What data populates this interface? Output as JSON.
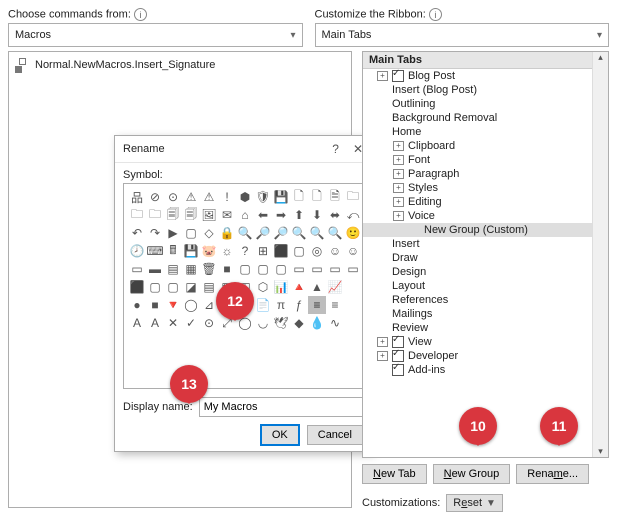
{
  "top": {
    "left_label": "Choose commands from:",
    "right_label": "Customize the Ribbon:",
    "left_value": "Macros",
    "right_value": "Main Tabs"
  },
  "macro_item": "Normal.NewMacros.Insert_Signature",
  "tree": {
    "header": "Main Tabs",
    "nodes": [
      {
        "d": 0,
        "exp": "+",
        "chk": true,
        "label": "Blog Post"
      },
      {
        "d": 0,
        "exp": "",
        "chk": null,
        "label": "Insert (Blog Post)"
      },
      {
        "d": 0,
        "exp": "",
        "chk": null,
        "label": "Outlining"
      },
      {
        "d": 0,
        "exp": "",
        "chk": null,
        "label": "Background Removal"
      },
      {
        "d": 0,
        "exp": "",
        "chk": null,
        "label": "Home"
      },
      {
        "d": 1,
        "exp": "+",
        "chk": null,
        "label": "Clipboard"
      },
      {
        "d": 1,
        "exp": "+",
        "chk": null,
        "label": "Font"
      },
      {
        "d": 1,
        "exp": "+",
        "chk": null,
        "label": "Paragraph"
      },
      {
        "d": 1,
        "exp": "+",
        "chk": null,
        "label": "Styles"
      },
      {
        "d": 1,
        "exp": "+",
        "chk": null,
        "label": "Editing"
      },
      {
        "d": 1,
        "exp": "+",
        "chk": null,
        "label": "Voice"
      },
      {
        "d": 2,
        "exp": "",
        "chk": null,
        "label": "New Group (Custom)",
        "sel": true
      },
      {
        "d": 0,
        "exp": "",
        "chk": null,
        "label": "Insert"
      },
      {
        "d": 0,
        "exp": "",
        "chk": null,
        "label": "Draw"
      },
      {
        "d": 0,
        "exp": "",
        "chk": null,
        "label": "Design"
      },
      {
        "d": 0,
        "exp": "",
        "chk": null,
        "label": "Layout"
      },
      {
        "d": 0,
        "exp": "",
        "chk": null,
        "label": "References"
      },
      {
        "d": 0,
        "exp": "",
        "chk": null,
        "label": "Mailings"
      },
      {
        "d": 0,
        "exp": "",
        "chk": null,
        "label": "Review"
      },
      {
        "d": 0,
        "exp": "+",
        "chk": true,
        "label": "View"
      },
      {
        "d": 0,
        "exp": "+",
        "chk": true,
        "label": "Developer"
      },
      {
        "d": 0,
        "exp": "",
        "chk": true,
        "label": "Add-ins"
      }
    ]
  },
  "buttons": {
    "new_tab": "New Tab",
    "new_group": "New Group",
    "rename": "Rename...",
    "customizations": "Customizations:",
    "reset": "Reset"
  },
  "dialog": {
    "title": "Rename",
    "symbol_label": "Symbol:",
    "display_name_label": "Display name:",
    "display_name_value": "My Macros",
    "ok": "OK",
    "cancel": "Cancel",
    "symbols": [
      "品",
      "⊘",
      "⊙",
      "⚠",
      "⚠",
      "!",
      "⬢",
      "🛡",
      "💾",
      "🗋",
      "🗋",
      "🗎",
      "🗀",
      "🗀",
      "🗀",
      "🗐",
      "🗐",
      "🖼",
      "✉",
      "⌂",
      "⬅",
      "➡",
      "⬆",
      "⬇",
      "⬌",
      "⤺",
      "↶",
      "↷",
      "▶",
      "▢",
      "◇",
      "🔒",
      "🔍",
      "🔎",
      "🔎",
      "🔍",
      "🔍",
      "🔍",
      "🙂",
      "🕗",
      "⌨",
      "🖩",
      "💾",
      "🐷",
      "☼",
      "?",
      "⊞",
      "⬛",
      "▢",
      "◎",
      "☺",
      "☺",
      "▭",
      "▬",
      "▤",
      "▦",
      "🗑",
      "■",
      "▢",
      "▢",
      "▢",
      "▭",
      "▭",
      "▭",
      "▭",
      "⬛",
      "▢",
      "▢",
      "◪",
      "▤",
      "▦",
      "◫",
      "⬡",
      "📊",
      "🔺",
      "▲",
      "📈",
      "",
      "●",
      "■",
      "🔻",
      "◯",
      "⊿",
      "🗂",
      "🗋",
      "📄",
      "π",
      "ƒ",
      "≡",
      "≡",
      "",
      "A",
      "A",
      "✕",
      "✓",
      "⊙",
      "⤢",
      "◯",
      "◡",
      "🕊",
      "◆",
      "💧",
      "∿",
      ""
    ]
  },
  "markers": {
    "m10": "10",
    "m11": "11",
    "m12": "12",
    "m13": "13"
  }
}
